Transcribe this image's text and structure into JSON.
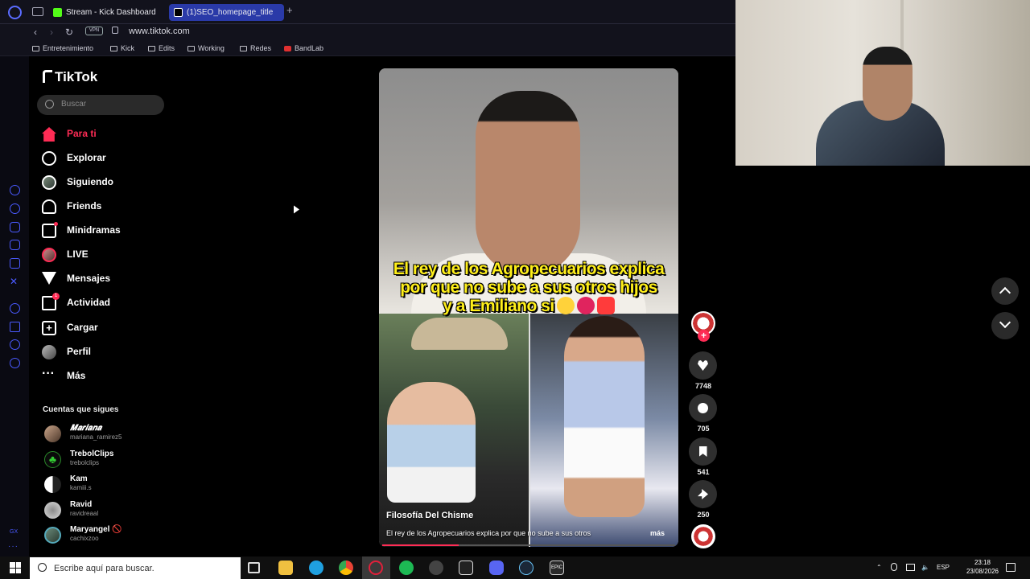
{
  "browser": {
    "tabs": [
      {
        "label": "Stream - Kick Dashboard",
        "icon": "kick-icon",
        "color": "#53fc18"
      },
      {
        "label": "(1)SEO_homepage_title",
        "icon": "tiktok-icon",
        "color": "#000000",
        "active": true
      }
    ],
    "vpn_label": "VPN",
    "url": "www.tiktok.com",
    "bookmarks": [
      "Entretenimiento",
      "Kick",
      "Edits",
      "Working",
      "Redes",
      "BandLab"
    ]
  },
  "tiktok": {
    "logo": "TikTok",
    "search_placeholder": "Buscar",
    "nav": [
      {
        "label": "Para ti",
        "icon": "home-icon",
        "active": true
      },
      {
        "label": "Explorar",
        "icon": "compass-icon"
      },
      {
        "label": "Siguiendo",
        "icon": "following-avatar-icon"
      },
      {
        "label": "Friends",
        "icon": "friends-icon"
      },
      {
        "label": "Minidramas",
        "icon": "film-icon"
      },
      {
        "label": "LIVE",
        "icon": "live-icon"
      },
      {
        "label": "Mensajes",
        "icon": "send-icon"
      },
      {
        "label": "Actividad",
        "icon": "activity-icon",
        "badge": "1"
      },
      {
        "label": "Cargar",
        "icon": "upload-icon"
      },
      {
        "label": "Perfil",
        "icon": "profile-icon"
      },
      {
        "label": "Más",
        "icon": "more-icon"
      }
    ],
    "following_title": "Cuentas que sigues",
    "following": [
      {
        "name": "𝑴𝒂𝒓𝒊𝒂𝒏𝒂",
        "username": "mariana_ramirez5"
      },
      {
        "name": "TrebolClips",
        "username": "trebolclips"
      },
      {
        "name": "Kam",
        "username": "kamiii.s"
      },
      {
        "name": "Ravid",
        "username": "ravidreaal"
      },
      {
        "name": "Maryangel 🚫",
        "username": "cachixzoo"
      }
    ]
  },
  "video": {
    "caption_line1": "El rey de los Agropecuarios explica",
    "caption_line2": "por que no sube a sus otros hijos",
    "caption_line3": "y a Emiliano si",
    "author": "Filosofía Del Chisme",
    "description": "El rey de los Agropecuarios explica por que no sube a sus otros",
    "more_label": "más",
    "progress": 0.26,
    "likes": "7748",
    "comments": "705",
    "saves": "541",
    "shares": "250"
  },
  "taskbar": {
    "search_placeholder": "Escribe aquí para buscar.",
    "language": "ESP",
    "time": "23:18",
    "date": "23/08/2026"
  },
  "colors": {
    "accent": "#fe2c55",
    "tab_active": "#2a3aa8",
    "caption": "#ffef1a"
  }
}
